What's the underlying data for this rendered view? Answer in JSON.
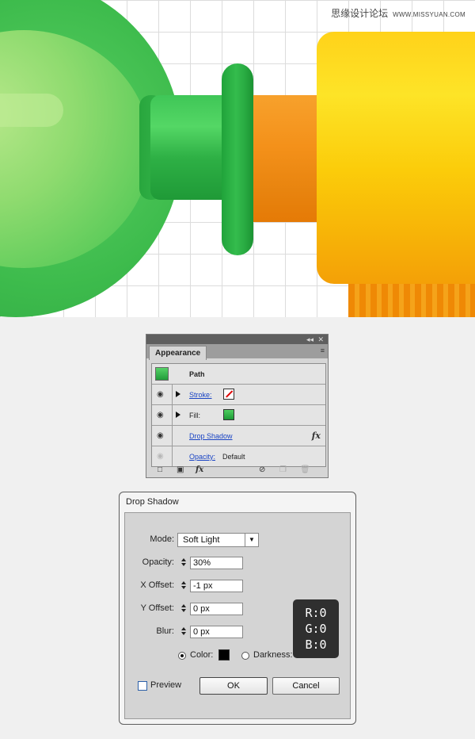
{
  "watermark": {
    "chinese": "思缘设计论坛",
    "url": "WWW.MISSYUAN.COM"
  },
  "appearance_panel": {
    "title_buttons": {
      "collapse": "◂◂",
      "close": "✕"
    },
    "tab_label": "Appearance",
    "menu_icon": "≡",
    "object_label": "Path",
    "rows": {
      "stroke": {
        "label": "Stroke:"
      },
      "fill": {
        "label": "Fill:"
      },
      "drop_shadow": {
        "label": "Drop Shadow",
        "fx": "fx"
      },
      "opacity": {
        "label": "Opacity:",
        "value": "Default"
      }
    },
    "bottom_icons": [
      "add-stroke-icon",
      "add-fill-icon",
      "fx-menu-icon",
      "clear-icon",
      "duplicate-icon",
      "trash-icon"
    ],
    "bottom_fx": "fx"
  },
  "drop_shadow_dialog": {
    "title": "Drop Shadow",
    "mode": {
      "label": "Mode:",
      "value": "Soft Light",
      "arrow": "▼"
    },
    "opacity": {
      "label": "Opacity:",
      "value": "30%"
    },
    "x_offset": {
      "label": "X Offset:",
      "value": "-1 px"
    },
    "y_offset": {
      "label": "Y Offset:",
      "value": "0 px"
    },
    "blur": {
      "label": "Blur:",
      "value": "0 px"
    },
    "color": {
      "label": "Color:",
      "swatch": "#000000",
      "selected": true
    },
    "darkness": {
      "label": "Darkness:"
    },
    "preview": {
      "label": "Preview",
      "checked": false
    },
    "ok_label": "OK",
    "cancel_label": "Cancel"
  },
  "rgb_callout": {
    "r": "R:0",
    "g": "G:0",
    "b": "B:0"
  },
  "colors": {
    "green": "#3dbb4c",
    "orange": "#f4911a",
    "yellow": "#fbcc0a"
  }
}
